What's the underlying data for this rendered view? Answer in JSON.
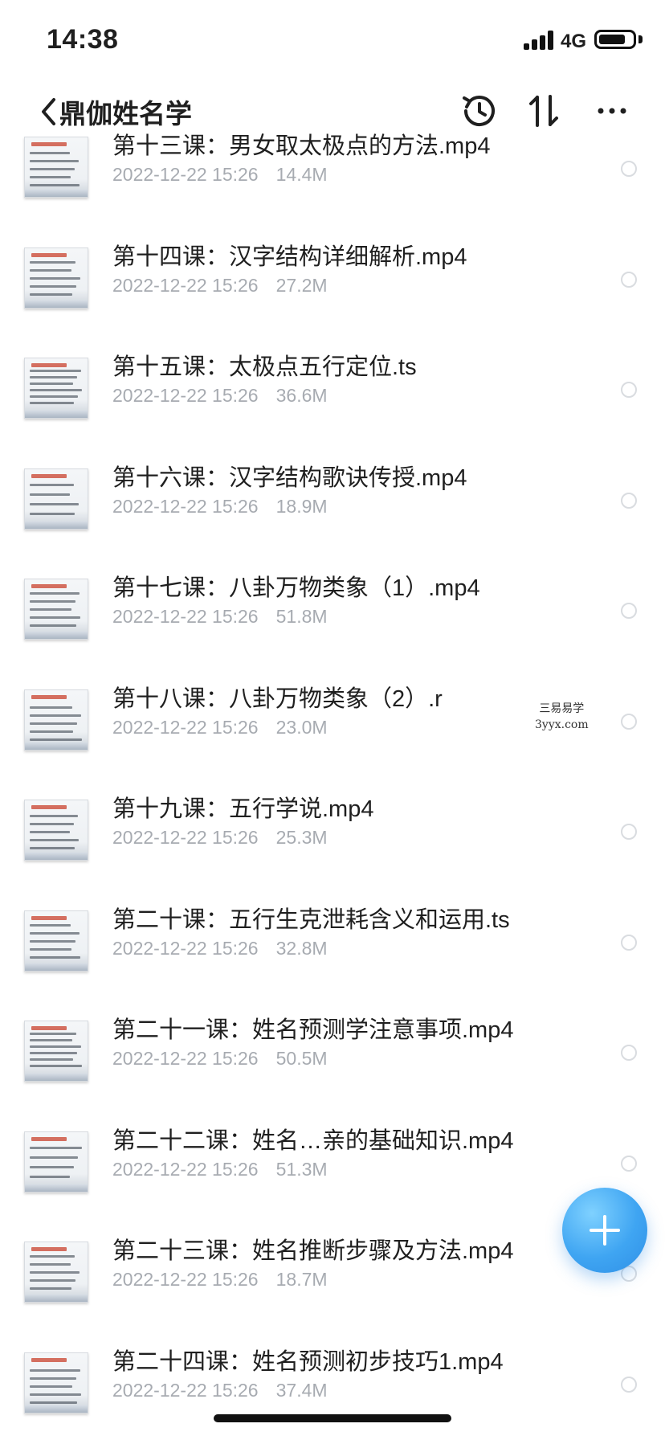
{
  "status_bar": {
    "time": "14:38",
    "network": "4G",
    "battery_level": 0.8
  },
  "nav": {
    "title": "鼎伽姓名学",
    "icons": [
      "back-chevron-icon",
      "history-icon",
      "sort-icon",
      "more-icon"
    ]
  },
  "files": [
    {
      "name": "第十三课：男女取太极点的方法.mp4",
      "date": "2022-12-22 15:26",
      "size": "14.4M"
    },
    {
      "name": "第十四课：汉字结构详细解析.mp4",
      "date": "2022-12-22 15:26",
      "size": "27.2M"
    },
    {
      "name": "第十五课：太极点五行定位.ts",
      "date": "2022-12-22 15:26",
      "size": "36.6M"
    },
    {
      "name": "第十六课：汉字结构歌诀传授.mp4",
      "date": "2022-12-22 15:26",
      "size": "18.9M"
    },
    {
      "name": "第十七课：八卦万物类象（1）.mp4",
      "date": "2022-12-22 15:26",
      "size": "51.8M"
    },
    {
      "name": "第十八课：八卦万物类象（2）.r",
      "date": "2022-12-22 15:26",
      "size": "23.0M"
    },
    {
      "name": "第十九课：五行学说.mp4",
      "date": "2022-12-22 15:26",
      "size": "25.3M"
    },
    {
      "name": "第二十课：五行生克泄耗含义和运用.ts",
      "date": "2022-12-22 15:26",
      "size": "32.8M"
    },
    {
      "name": "第二十一课：姓名预测学注意事项.mp4",
      "date": "2022-12-22 15:26",
      "size": "50.5M"
    },
    {
      "name": "第二十二课：姓名…亲的基础知识.mp4",
      "date": "2022-12-22 15:26",
      "size": "51.3M"
    },
    {
      "name": "第二十三课：姓名推断步骤及方法.mp4",
      "date": "2022-12-22 15:26",
      "size": "18.7M"
    },
    {
      "name": "第二十四课：姓名预测初步技巧1.mp4",
      "date": "2022-12-22 15:26",
      "size": "37.4M"
    }
  ],
  "watermark": {
    "line1": "三易易学",
    "line2": "3yyx.com"
  },
  "fab": {
    "icon": "plus-icon"
  },
  "colors": {
    "accent": "#3fa5f2",
    "meta_text": "#a7abb1",
    "radio_border": "#d9dce0"
  }
}
